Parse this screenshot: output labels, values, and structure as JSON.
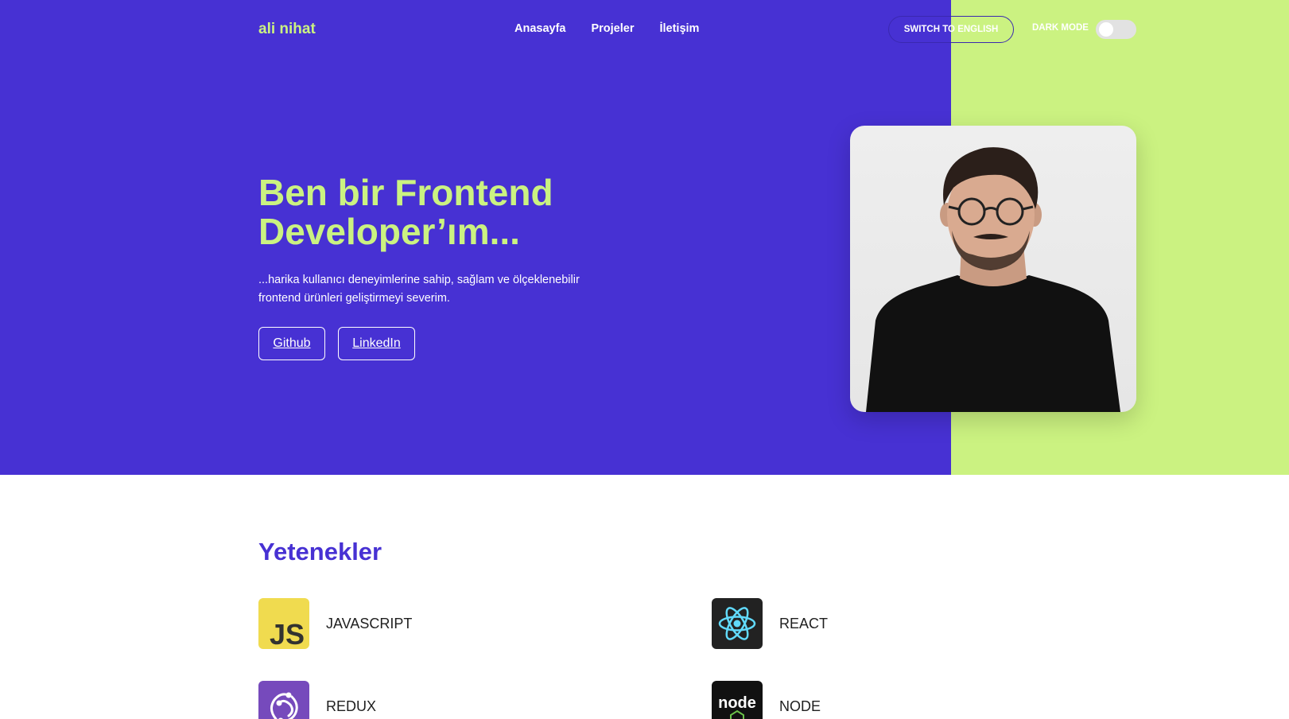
{
  "header": {
    "logo": "ali nihat",
    "nav": [
      "Anasayfa",
      "Projeler",
      "İletişim"
    ],
    "lang_button": "SWITCH TO ENGLISH",
    "dark_mode_label": "DARK MODE",
    "dark_mode_on": false
  },
  "hero": {
    "headline_line1": "Ben bir Frontend",
    "headline_line2": "Developer’ım...",
    "lead": "...harika kullanıcı deneyimlerine sahip, sağlam ve ölçeklenebilir frontend ürünleri geliştirmeyi severim.",
    "buttons": [
      "Github",
      "LinkedIn"
    ]
  },
  "skills": {
    "title": "Yetenekler",
    "items": [
      {
        "name": "JAVASCRIPT",
        "icon": "javascript-icon"
      },
      {
        "name": "REACT",
        "icon": "react-icon"
      },
      {
        "name": "REDUX",
        "icon": "redux-icon"
      },
      {
        "name": "NODE",
        "icon": "node-icon"
      }
    ]
  },
  "colors": {
    "primary": "#4731d3",
    "accent": "#cbf281",
    "text": "#1f1f1f"
  }
}
